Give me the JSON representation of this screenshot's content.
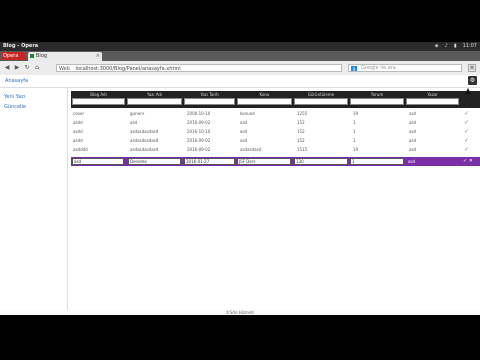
{
  "window": {
    "title": "Blog - Opera"
  },
  "tray": {
    "clock": "11:07"
  },
  "browser": {
    "opera_label": "Opera",
    "tab_label": "Blog",
    "tab_close": "×",
    "url_badge": "Web",
    "url": "localhost:3000/Blog/Panel/anasayfa.xhtml",
    "search_placeholder": "Google ile ara",
    "search_engine_icon": "google-icon"
  },
  "page": {
    "breadcrumb": "Anasayfa",
    "sidebar": [
      {
        "label": "Yeni Yazı"
      },
      {
        "label": "Güncelle"
      }
    ],
    "table": {
      "columns": [
        {
          "label": "Blog Adı"
        },
        {
          "label": "Yazı Adı"
        },
        {
          "label": "Yazı Tarih"
        },
        {
          "label": "Konu"
        },
        {
          "label": "Görüntüleme"
        },
        {
          "label": "Yorum"
        },
        {
          "label": "Yazar"
        }
      ],
      "rows": [
        {
          "c0": "cover",
          "c1": "gunenr",
          "c2": "2000-10-10",
          "c3": "konuod",
          "c4": "1255",
          "c5": "19",
          "c6": "asd"
        },
        {
          "c0": "asdd",
          "c1": "asd",
          "c2": "2016-09-02",
          "c3": "asd",
          "c4": "152",
          "c5": "1",
          "c6": "asd"
        },
        {
          "c0": "asdd",
          "c1": "asdasdasdasd",
          "c2": "2016-10-10",
          "c3": "asd",
          "c4": "152",
          "c5": "1",
          "c6": "asd"
        },
        {
          "c0": "asdd",
          "c1": "asdasdasdasd",
          "c2": "2016-09-02",
          "c3": "asd",
          "c4": "152",
          "c5": "1",
          "c6": "asd"
        },
        {
          "c0": "asdddd",
          "c1": "asdasdasdasd",
          "c2": "2016-09-02",
          "c3": "asdasdasd",
          "c4": "1515",
          "c5": "19",
          "c6": "asd"
        }
      ],
      "edit_row": {
        "c0": "asd",
        "c1": "Deneme",
        "c2": "2016-01-27",
        "c3": "JSF Ders",
        "c4": "130",
        "c5": "1",
        "c6": "asd",
        "actions": "✓ ✕"
      },
      "check_glyph": "✓"
    },
    "footer": "©Site Hizmeti"
  }
}
